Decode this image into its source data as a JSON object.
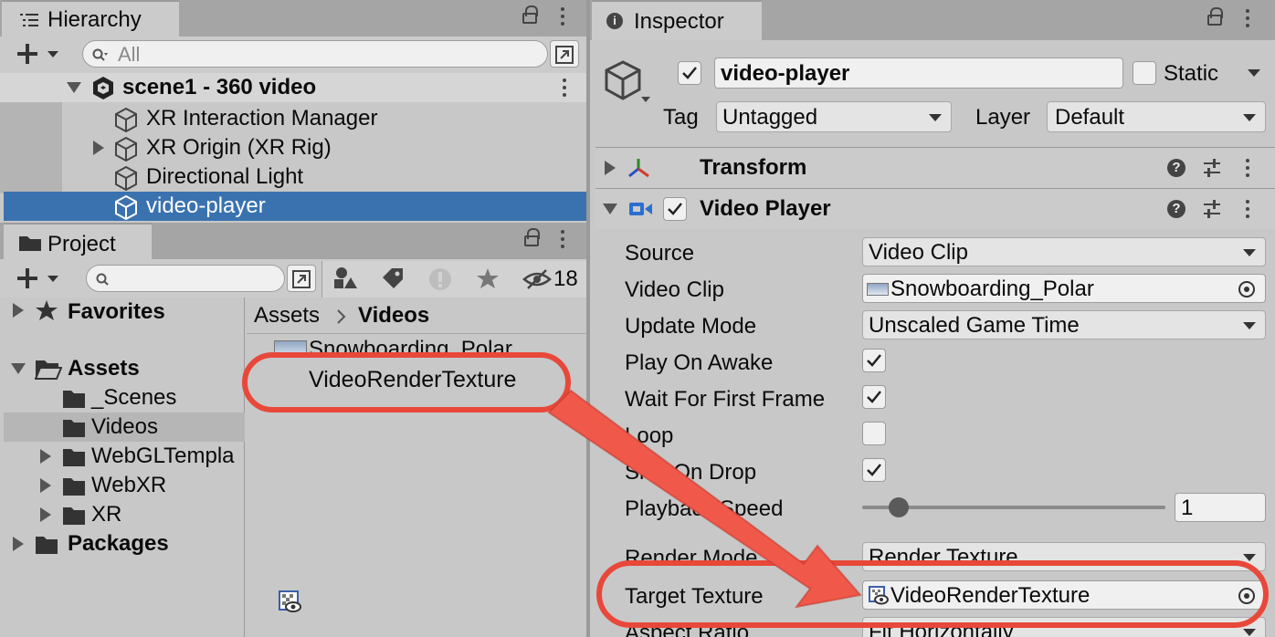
{
  "hierarchy": {
    "tab_label": "Hierarchy",
    "search_placeholder": "All",
    "scene_name": "scene1 - 360 video",
    "items": [
      {
        "label": "XR Interaction Manager"
      },
      {
        "label": "XR Origin (XR Rig)"
      },
      {
        "label": "Directional Light"
      },
      {
        "label": "video-player"
      }
    ]
  },
  "project": {
    "tab_label": "Project",
    "hidden_count": "18",
    "tree": {
      "favorites": "Favorites",
      "assets": "Assets",
      "assets_children": [
        "_Scenes",
        "Videos",
        "WebGLTempla",
        "WebXR",
        "XR"
      ],
      "packages": "Packages"
    },
    "breadcrumb": {
      "root": "Assets",
      "current": "Videos"
    },
    "files": [
      "Snowboarding_Polar",
      "VideoRenderTexture"
    ]
  },
  "inspector": {
    "tab_label": "Inspector",
    "object_name": "video-player",
    "static_label": "Static",
    "tag_label": "Tag",
    "tag_value": "Untagged",
    "layer_label": "Layer",
    "layer_value": "Default",
    "transform_label": "Transform",
    "video_player_label": "Video Player",
    "props": {
      "source_label": "Source",
      "source_value": "Video Clip",
      "video_clip_label": "Video Clip",
      "video_clip_value": "Snowboarding_Polar",
      "update_mode_label": "Update Mode",
      "update_mode_value": "Unscaled Game Time",
      "play_on_awake_label": "Play On Awake",
      "wait_first_frame_label": "Wait For First Frame",
      "loop_label": "Loop",
      "skip_on_drop_label": "Skip On Drop",
      "playback_speed_label": "Playback Speed",
      "playback_speed_value": "1",
      "render_mode_label": "Render Mode",
      "render_mode_value": "Render Texture",
      "target_texture_label": "Target Texture",
      "target_texture_value": "VideoRenderTexture",
      "aspect_ratio_label": "Aspect Ratio",
      "aspect_ratio_value": "Fit Horizontally"
    },
    "checks": {
      "play_on_awake": true,
      "wait_first_frame": true,
      "loop": false,
      "skip_on_drop": true
    },
    "playback_slider_level": 0.12
  },
  "annotation": {
    "color": "#f0584a",
    "arrow_from": "VideoRenderTexture",
    "arrow_to": "Target Texture"
  }
}
